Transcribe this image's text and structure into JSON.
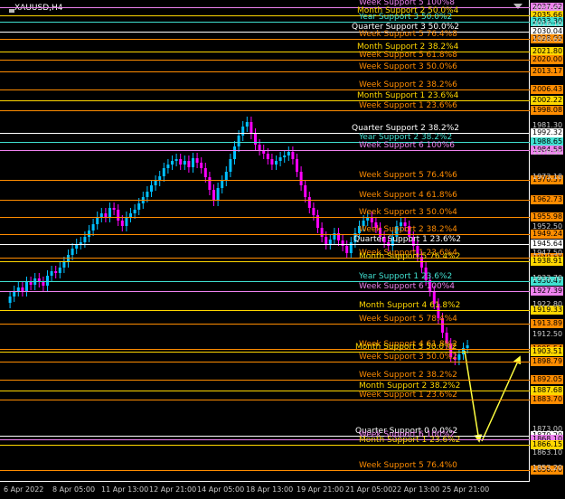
{
  "window": {
    "title": "XAUUSD,H4"
  },
  "icons": {
    "menu": "menu-icon",
    "arrow": "scroll-down-arrow-icon"
  },
  "levels": [
    {
      "text": "Week Support 5 100%8",
      "color": "#ee82ee",
      "price": "2037.62"
    },
    {
      "text": "Month Support 2 50.0%4",
      "color": "#ffd700",
      "price": "2035.66"
    },
    {
      "text": "Year Support 3 50.0%2",
      "color": "#40e0d0",
      "price": "2033.30"
    },
    {
      "text": "Quarter Support 3 50.0%2",
      "color": "#ffffff",
      "price": "2030.04"
    },
    {
      "text": "Week Support 5 76.4%8",
      "color": "#ff8c00",
      "price": "2028.09"
    },
    {
      "text": "Month Support 2 38.2%4",
      "color": "#ffd700",
      "price": "2021.80"
    },
    {
      "text": "Week Support 5 61.8%8",
      "color": "#ff8c00",
      "price": "2020.00"
    },
    {
      "text": "Week Support 3 50.0%6",
      "color": "#ff8c00",
      "price": "2013.17"
    },
    {
      "text": "Week Support 2 38.2%6",
      "color": "#ff8c00",
      "price": "2006.43"
    },
    {
      "text": "Month Support 1 23.6%4",
      "color": "#ffd700",
      "price": "2002.22"
    },
    {
      "text": "Week Support 1 23.6%6",
      "color": "#ff8c00",
      "price": "1998.08"
    },
    {
      "text": "Quarter Support 2 38.2%2",
      "color": "#ffffff",
      "price": "1992.32"
    },
    {
      "text": "Year Support 2 38.2%2",
      "color": "#40e0d0",
      "price": "1988.65"
    },
    {
      "text": "Week Support 6 100%6",
      "color": "#ee82ee",
      "price": "1984.58"
    },
    {
      "text": "Week Support 5 76.4%6",
      "color": "#ff8c00",
      "price": "1970.57"
    },
    {
      "text": "Week Support 4 61.8%6",
      "color": "#ff8c00",
      "price": "1962.73"
    },
    {
      "text": "Week Support 3 50.0%4",
      "color": "#ff8c00",
      "price": "1955.98"
    },
    {
      "text": "Week Support 2 38.2%4",
      "color": "#ff8c00",
      "price": "1949.24"
    },
    {
      "text": "Quarter Support 1 23.6%2",
      "color": "#ffffff",
      "price": "1945.64"
    },
    {
      "text": "Week Support 1 23.6%4",
      "color": "#ff8c00",
      "price": "1940.58"
    },
    {
      "text": "Month Support 5 76.4%2",
      "color": "#ffd700",
      "price": "1938.91"
    },
    {
      "text": "Year Support 1 23.6%2",
      "color": "#40e0d0",
      "price": "1930.47"
    },
    {
      "text": "Week Support 6 100%4",
      "color": "#ee82ee",
      "price": "1927.39"
    },
    {
      "text": "Month Support 4 61.8%2",
      "color": "#ffd700",
      "price": "1919.33"
    },
    {
      "text": "Week Support 5 78.4%4",
      "color": "#ff8c00",
      "price": "1913.89"
    },
    {
      "text": "Week Support 4 61.8%2",
      "color": "#ff8c00",
      "price": "1905.54"
    },
    {
      "text": "Month Support 3 50.0%2",
      "color": "#ffd700",
      "price": "1903.51"
    },
    {
      "text": "Week Support 3 50.0%2",
      "color": "#ff8c00",
      "price": "1898.79"
    },
    {
      "text": "Week Support 2 38.2%2",
      "color": "#ff8c00",
      "price": "1892.05"
    },
    {
      "text": "Month Support 2 38.2%2",
      "color": "#ffd700",
      "price": "1887.68"
    },
    {
      "text": "Week Support 1 23.6%2",
      "color": "#ff8c00",
      "price": "1883.70"
    },
    {
      "text": "Quarter Support 0 0.0%2",
      "color": "#ffffff",
      "price": "1870.20"
    },
    {
      "text": "Week Support 6 100%2",
      "color": "#ee82ee",
      "price": "1868.10"
    },
    {
      "text": "Month Support 1 23.6%2",
      "color": "#ffd700",
      "price": "1866.15"
    },
    {
      "text": "Week Support 5 76.4%0",
      "color": "#ff8c00",
      "price": "1856.70"
    }
  ],
  "yaxis_plain": [
    {
      "price": "2027.63"
    },
    {
      "price": "2016.10"
    },
    {
      "price": "1998.65"
    },
    {
      "price": "1981.30"
    },
    {
      "price": "1978.55"
    },
    {
      "price": "1973.18"
    },
    {
      "price": "1952.50"
    },
    {
      "price": "1947.50"
    },
    {
      "price": "1933.70"
    },
    {
      "price": "1922.80"
    },
    {
      "price": "1912.50"
    },
    {
      "price": "1873.00"
    },
    {
      "price": "1863.10"
    },
    {
      "price": "1853.20"
    }
  ],
  "xaxis": [
    "6 Apr 2022",
    "8 Apr 05:00",
    "11 Apr 13:00",
    "12 Apr 21:00",
    "14 Apr 05:00",
    "18 Apr 13:00",
    "19 Apr 21:00",
    "21 Apr 05:00",
    "22 Apr 13:00",
    "25 Apr 21:00"
  ],
  "colors": {
    "bull": "#00bfff",
    "bear": "#ff00ff",
    "forecast": "#ffff40"
  }
}
